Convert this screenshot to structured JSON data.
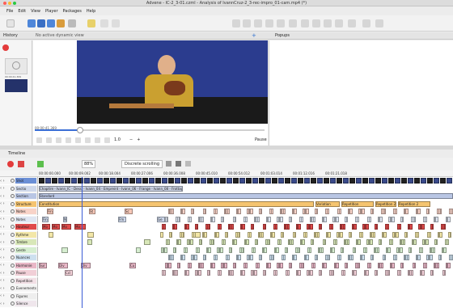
{
  "app": {
    "title": "Advene - IC-2_3-01.czml - Analysis of IvannCruz-2_3-rec-impro_01-cam.mp4 (*)"
  },
  "menu": [
    "File",
    "Edit",
    "View",
    "Player",
    "Packages",
    "Help"
  ],
  "tabs": {
    "history": "History",
    "no_dynamic_view": "No active dynamic view",
    "popups": "Popups"
  },
  "video": {
    "time_label": "00:00:41.369",
    "speed_value": "1.0",
    "status": "Pause"
  },
  "thumbnail": {
    "time_label": "00:00:41.369"
  },
  "timeline": {
    "title": "Timeline",
    "zoom": "88%",
    "scroll_mode": "Discrete scrolling",
    "ruler_ticks": [
      "00:00:00.000",
      "00:00:09.002",
      "00:00:18.004",
      "00:00:27.006",
      "00:00:36.008",
      "00:00:45.010",
      "00:00:54.012",
      "00:01:03.014",
      "00:01:12.016",
      "00:01:21.018"
    ]
  },
  "rows": [
    {
      "label": "Shot",
      "color": "#6b8fd6",
      "anns": []
    },
    {
      "label": "Sectio",
      "color": "#cfd8ea",
      "anns": [
        {
          "t": "Chapitre - Ivann_IC - Dessi - Ivann_04 - Empreint - Ivann_06 - Frange - Ivann_08 - Frottage - Ivann_09 - Balaide - Ivann_10",
          "c": "#c8cfe0",
          "s": 0,
          "w": 178
        }
      ]
    },
    {
      "label": "Section",
      "color": "#b9c6e4",
      "anns": [
        {
          "t": "Standard",
          "c": "#b9c6e4",
          "s": 0,
          "w": 512
        }
      ]
    },
    {
      "label": "Structure",
      "color": "#f5c470",
      "anns": [
        {
          "t": "Constitution",
          "c": "#f5c470",
          "s": 0,
          "w": 340
        },
        {
          "t": "Variation",
          "c": "#f5c470",
          "s": 342,
          "w": 30
        },
        {
          "t": "Repetition",
          "c": "#f5c470",
          "s": 374,
          "w": 40
        },
        {
          "t": "Repetition 2",
          "c": "#f5c470",
          "s": 416,
          "w": 26
        },
        {
          "t": "Repetition 2",
          "c": "#f5c470",
          "s": 444,
          "w": 40
        }
      ]
    },
    {
      "label": "Notes",
      "color": "#f8d3c8",
      "anns": [
        {
          "t": "Fin",
          "c": "#f6c8b8",
          "s": 10,
          "w": 8
        },
        {
          "t": "St",
          "c": "#f6c8b8",
          "s": 62,
          "w": 8
        },
        {
          "t": "Sc",
          "c": "#f6c8b8",
          "s": 106,
          "w": 10
        }
      ]
    },
    {
      "label": "Notes",
      "color": "#dfe6f2",
      "anns": [
        {
          "t": "Fin",
          "c": "#cdd7ea",
          "s": 4,
          "w": 8
        },
        {
          "t": "N",
          "c": "#cdd7ea",
          "s": 30,
          "w": 5
        },
        {
          "t": "Fm",
          "c": "#cdd7ea",
          "s": 98,
          "w": 10
        },
        {
          "t": "Ge",
          "c": "#cdd7ea",
          "s": 146,
          "w": 10
        }
      ]
    },
    {
      "label": "Hauteur",
      "color": "#e04a4a",
      "anns": [
        {
          "t": "Mo",
          "c": "#e04a4a",
          "s": 4,
          "w": 10
        },
        {
          "t": "Mo",
          "c": "#e04a4a",
          "s": 16,
          "w": 10
        },
        {
          "t": "Mo",
          "c": "#e04a4a",
          "s": 28,
          "w": 12
        },
        {
          "t": "Mo",
          "c": "#e04a4a",
          "s": 44,
          "w": 14
        }
      ]
    },
    {
      "label": "Rythme",
      "color": "#f3e7a8",
      "anns": [
        {
          "t": "",
          "c": "#f3e7a8",
          "s": 12,
          "w": 6
        },
        {
          "t": "",
          "c": "#f3e7a8",
          "s": 60,
          "w": 8
        },
        {
          "t": "",
          "c": "#f3e7a8",
          "s": 190,
          "w": 10
        }
      ]
    },
    {
      "label": "Timbre",
      "color": "#d8e7b8",
      "anns": [
        {
          "t": "",
          "c": "#d8e7b8",
          "s": 60,
          "w": 6
        },
        {
          "t": "",
          "c": "#d8e7b8",
          "s": 130,
          "w": 8
        }
      ]
    },
    {
      "label": "Geste",
      "color": "#d6eed0",
      "anns": [
        {
          "t": "",
          "c": "#d6eed0",
          "s": 28,
          "w": 8
        },
        {
          "t": "",
          "c": "#d6eed0",
          "s": 120,
          "w": 6
        }
      ]
    },
    {
      "label": "Nuances",
      "color": "#cde0ef",
      "anns": []
    },
    {
      "label": "Harmonie",
      "color": "#e9b7c7",
      "anns": [
        {
          "t": "Sur",
          "c": "#e9b7c7",
          "s": 0,
          "w": 10
        },
        {
          "t": "Div",
          "c": "#e9b7c7",
          "s": 24,
          "w": 12
        },
        {
          "t": "Div",
          "c": "#e9b7c7",
          "s": 52,
          "w": 12
        },
        {
          "t": "Cu",
          "c": "#e9b7c7",
          "s": 112,
          "w": 8
        }
      ]
    },
    {
      "label": "Pause",
      "color": "#f1cfd7",
      "anns": [
        {
          "t": "Ccl",
          "c": "#f1cfd7",
          "s": 32,
          "w": 10
        }
      ]
    },
    {
      "label": "Repetition",
      "color": "#f2e0e6",
      "anns": []
    },
    {
      "label": "Evenements",
      "color": "#f2f2f2",
      "anns": []
    },
    {
      "label": "Figures",
      "color": "#eeeeee",
      "anns": []
    },
    {
      "label": "Silence",
      "color": "#efe6ec",
      "anns": []
    }
  ]
}
